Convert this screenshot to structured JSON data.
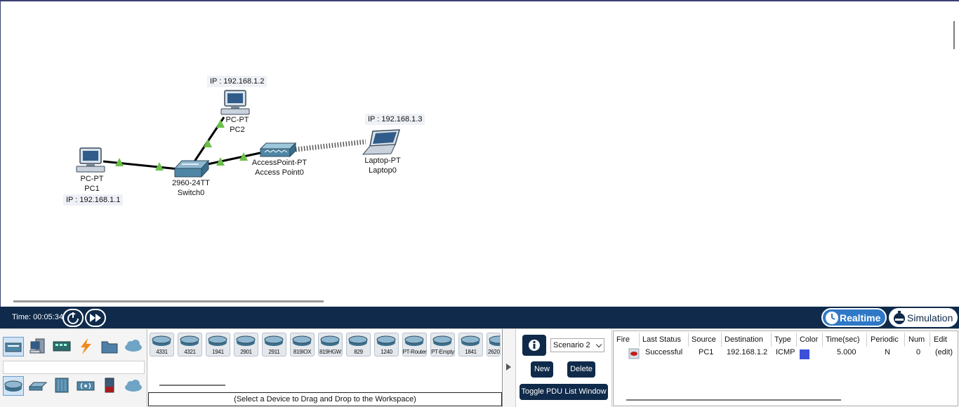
{
  "workspace": {
    "devices": [
      {
        "id": "pc1",
        "model": "PC-PT",
        "name": "PC1",
        "ip": "IP : 192.168.1.1"
      },
      {
        "id": "pc2",
        "model": "PC-PT",
        "name": "PC2",
        "ip": "IP : 192.168.1.2"
      },
      {
        "id": "switch0",
        "model": "2960-24TT",
        "name": "Switch0"
      },
      {
        "id": "ap0",
        "model": "AccessPoint-PT",
        "name": "Access Point0"
      },
      {
        "id": "laptop0",
        "model": "Laptop-PT",
        "name": "Laptop0",
        "ip": "IP : 192.168.1.3"
      }
    ],
    "link_status_color": "#6cc04a"
  },
  "timebar": {
    "time": "Time: 00:05:34",
    "reset_icon": "power-cycle-icon",
    "fast_forward_icon": "fast-forward-icon",
    "realtime_label": "Realtime",
    "simulation_label": "Simulation",
    "realtime_icon": "clock-icon",
    "simulation_icon": "stopwatch-icon"
  },
  "device_categories": {
    "top": [
      "network-devices-icon",
      "end-devices-icon",
      "components-icon",
      "connections-icon",
      "miscellaneous-icon",
      "multiuser-icon"
    ],
    "bottom": [
      "routers-icon",
      "switches-icon",
      "hubs-icon",
      "wireless-devices-icon",
      "security-icon",
      "wan-emulation-icon"
    ]
  },
  "device_list": {
    "items": [
      "4331",
      "4321",
      "1941",
      "2901",
      "2911",
      "819IOX",
      "819HGW",
      "829",
      "1240",
      "PT-Router",
      "PT-Empty",
      "1841",
      "2620"
    ],
    "hint": "(Select a Device to Drag and Drop to the Workspace)"
  },
  "scenario": {
    "selected": "Scenario 2",
    "new_label": "New",
    "delete_label": "Delete",
    "toggle_label": "Toggle PDU List Window"
  },
  "pdu_table": {
    "columns": [
      "Fire",
      "Last Status",
      "Source",
      "Destination",
      "Type",
      "Color",
      "Time(sec)",
      "Periodic",
      "Num",
      "Edit"
    ],
    "rows": [
      {
        "last_status": "Successful",
        "source": "PC1",
        "destination": "192.168.1.2",
        "type": "ICMP",
        "color": "#3b4fd8",
        "time": "5.000",
        "periodic": "N",
        "num": "0",
        "edit": "(edit)"
      }
    ]
  },
  "colors": {
    "navy": "#0f2a4a",
    "accent_blue": "#2e78c7"
  }
}
